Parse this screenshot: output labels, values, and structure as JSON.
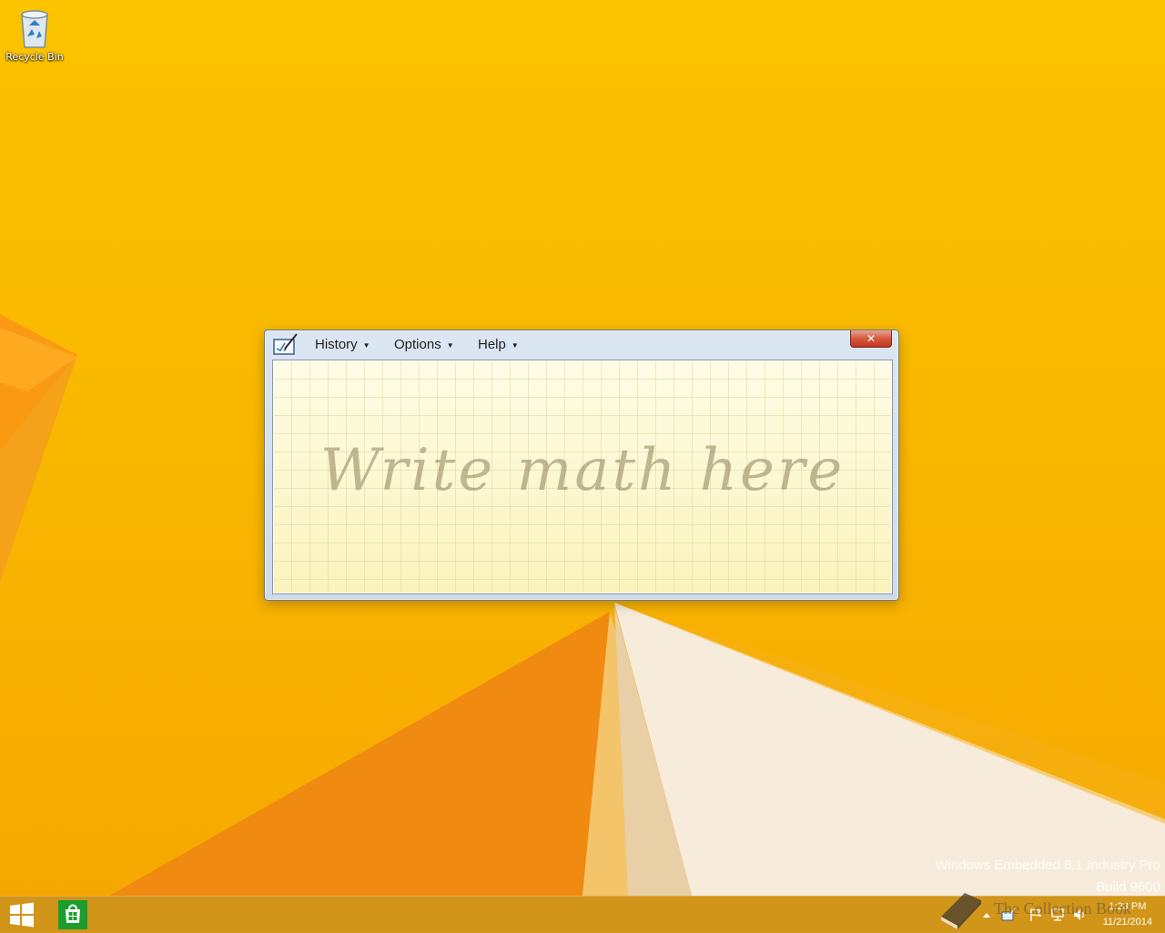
{
  "desktop": {
    "recycle_bin_label": "Recycle Bin"
  },
  "window": {
    "menus": [
      {
        "label": "History"
      },
      {
        "label": "Options"
      },
      {
        "label": "Help"
      }
    ],
    "close_label": "✕",
    "placeholder": "Write math here"
  },
  "watermark": {
    "line1": "Windows Embedded 8.1 Industry Pro",
    "line2": "Build 9600"
  },
  "taskbar": {
    "time": "1:23 PM",
    "date": "11/21/2014",
    "overlay_text": "The Collection Book"
  },
  "colors": {
    "wallpaper": "#fbc300",
    "store_green": "#1a9c2e",
    "taskbar": "#c8911e"
  },
  "icons": [
    "recycle-bin-icon",
    "math-input-panel-icon",
    "windows-start-icon",
    "store-icon",
    "tray-overflow-icon",
    "pen-icon",
    "flag-icon",
    "network-icon",
    "volume-icon",
    "book-icon"
  ]
}
